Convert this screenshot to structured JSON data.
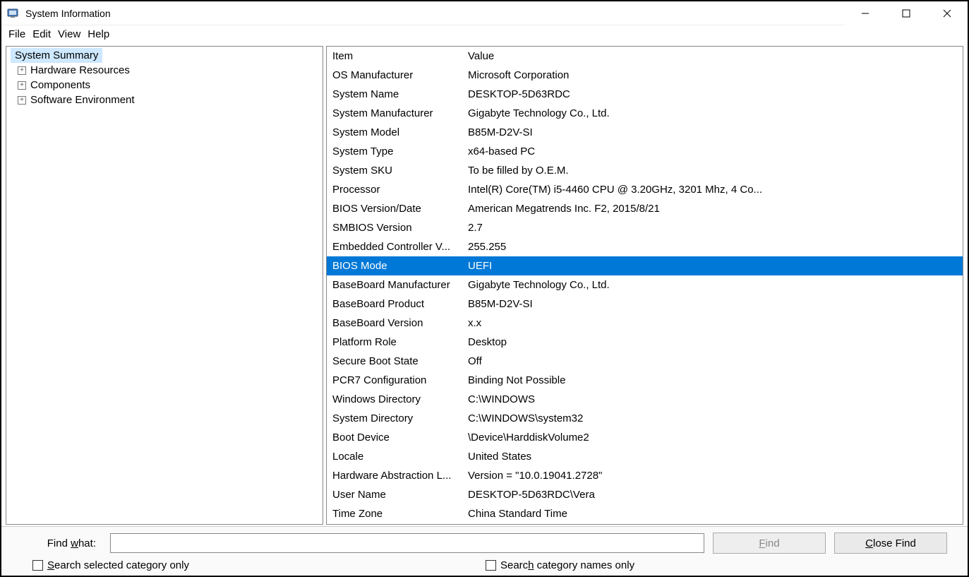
{
  "window": {
    "title": "System Information"
  },
  "menu": {
    "file": "File",
    "edit": "Edit",
    "view": "View",
    "help": "Help"
  },
  "tree": {
    "root": "System Summary",
    "items": [
      "Hardware Resources",
      "Components",
      "Software Environment"
    ]
  },
  "columns": {
    "item": "Item",
    "value": "Value"
  },
  "selectedRow": 9,
  "rows": [
    {
      "item": "OS Manufacturer",
      "value": "Microsoft Corporation"
    },
    {
      "item": "System Name",
      "value": "DESKTOP-5D63RDC"
    },
    {
      "item": "System Manufacturer",
      "value": "Gigabyte Technology Co., Ltd."
    },
    {
      "item": "System Model",
      "value": "B85M-D2V-SI"
    },
    {
      "item": "System Type",
      "value": "x64-based PC"
    },
    {
      "item": "System SKU",
      "value": "To be filled by O.E.M."
    },
    {
      "item": "Processor",
      "value": "Intel(R) Core(TM) i5-4460  CPU @ 3.20GHz, 3201 Mhz, 4 Co..."
    },
    {
      "item": "BIOS Version/Date",
      "value": "American Megatrends Inc. F2, 2015/8/21"
    },
    {
      "item": "SMBIOS Version",
      "value": "2.7"
    },
    {
      "item": "Embedded Controller V...",
      "value": "255.255"
    },
    {
      "item": "BIOS Mode",
      "value": "UEFI"
    },
    {
      "item": "BaseBoard Manufacturer",
      "value": "Gigabyte Technology Co., Ltd."
    },
    {
      "item": "BaseBoard Product",
      "value": "B85M-D2V-SI"
    },
    {
      "item": "BaseBoard Version",
      "value": "x.x"
    },
    {
      "item": "Platform Role",
      "value": "Desktop"
    },
    {
      "item": "Secure Boot State",
      "value": "Off"
    },
    {
      "item": "PCR7 Configuration",
      "value": "Binding Not Possible"
    },
    {
      "item": "Windows Directory",
      "value": "C:\\WINDOWS"
    },
    {
      "item": "System Directory",
      "value": "C:\\WINDOWS\\system32"
    },
    {
      "item": "Boot Device",
      "value": "\\Device\\HarddiskVolume2"
    },
    {
      "item": "Locale",
      "value": "United States"
    },
    {
      "item": "Hardware Abstraction L...",
      "value": "Version = \"10.0.19041.2728\""
    },
    {
      "item": "User Name",
      "value": "DESKTOP-5D63RDC\\Vera"
    },
    {
      "item": "Time Zone",
      "value": "China Standard Time"
    }
  ],
  "find": {
    "label": "Find what:",
    "value": "",
    "findBtn": "Find",
    "closeBtn": "Close Find",
    "chk1": "Search selected category only",
    "chk2": "Search category names only"
  }
}
